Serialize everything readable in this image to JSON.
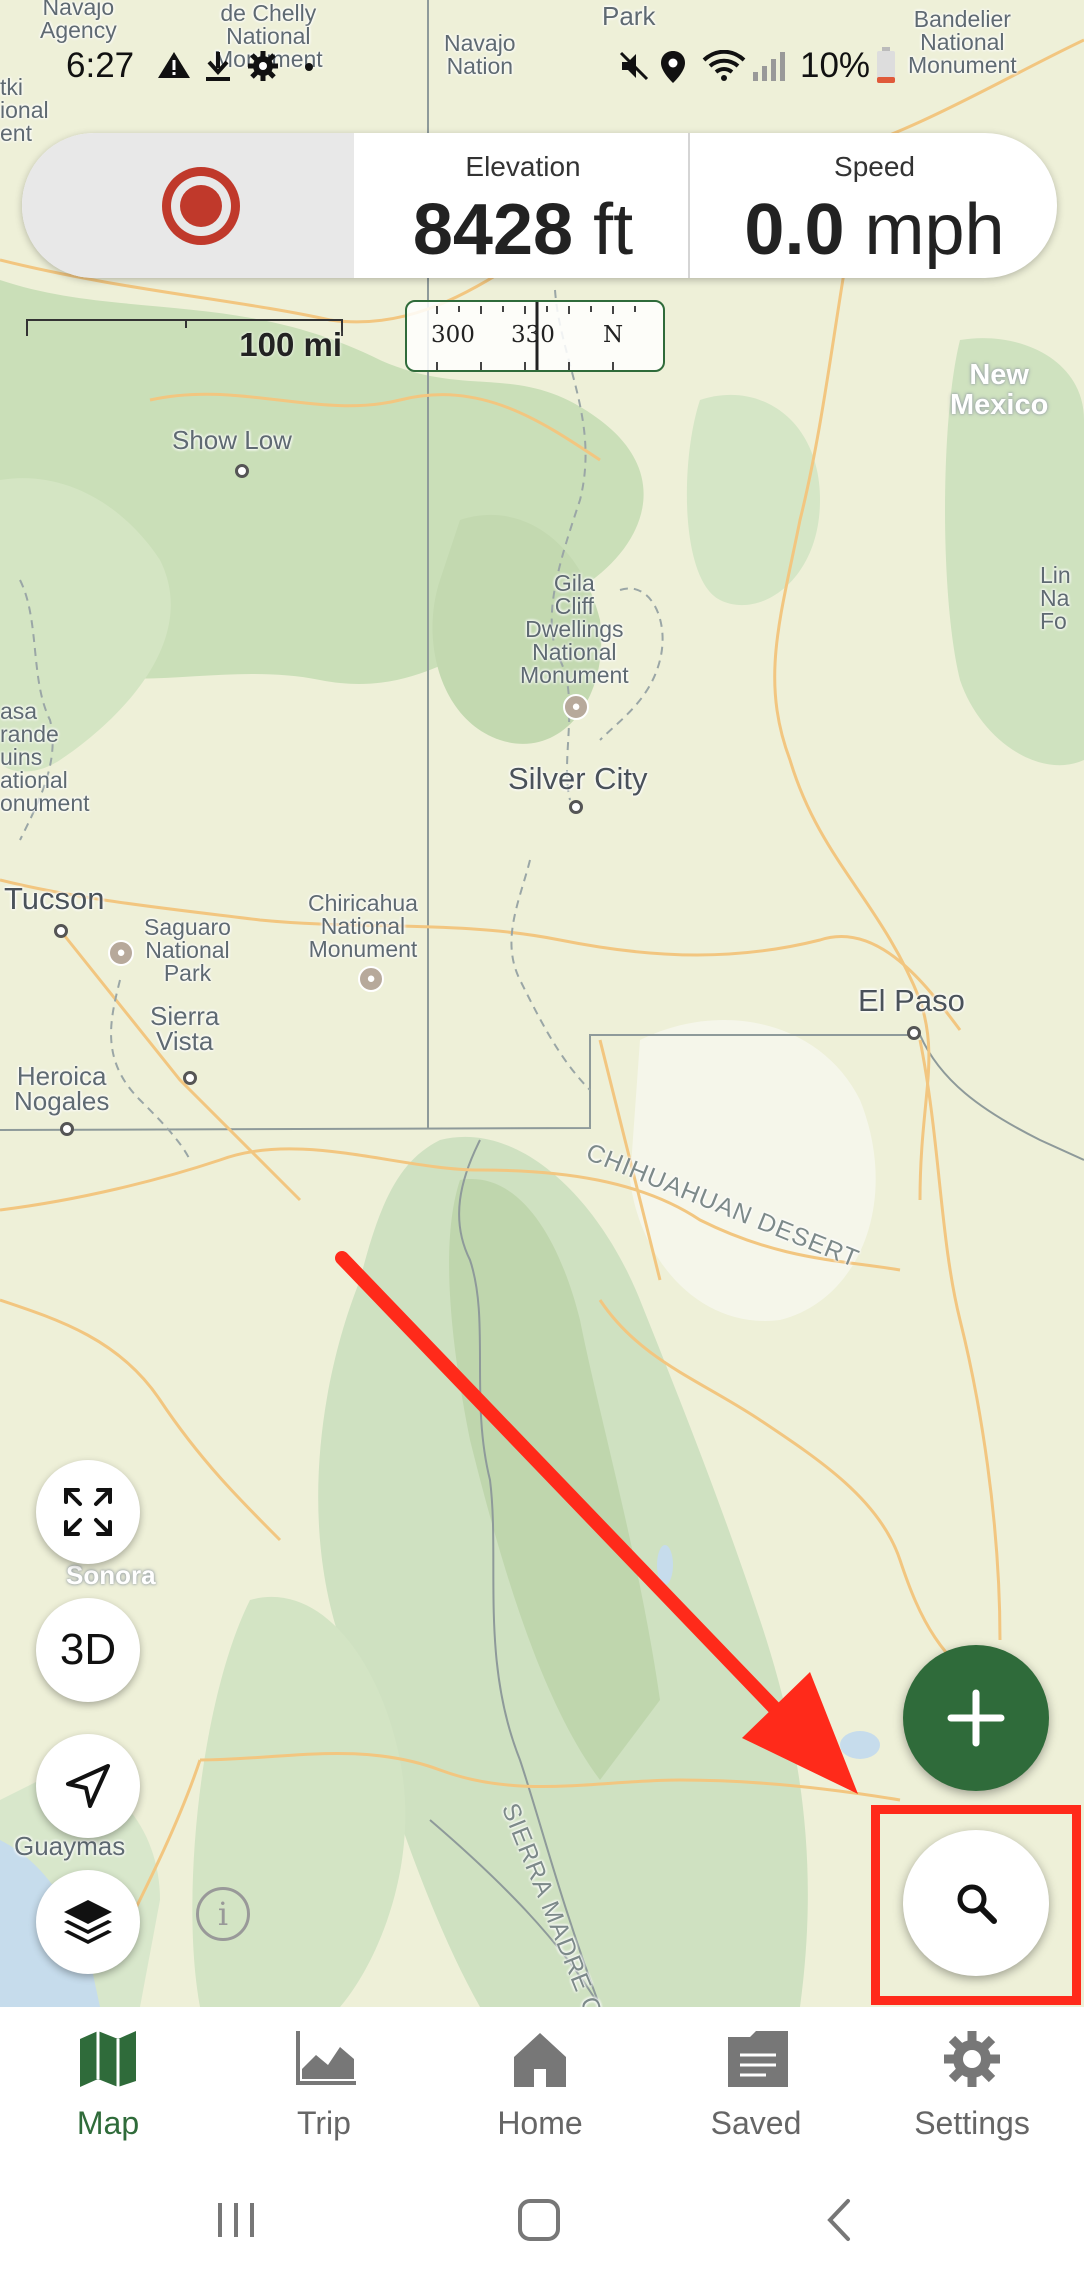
{
  "status_bar": {
    "time": "6:27",
    "battery": "10%",
    "icons": [
      "alert-icon",
      "download-icon",
      "settings-icon",
      "mute-icon",
      "location-icon",
      "wifi-icon",
      "signal-icon",
      "battery-icon"
    ]
  },
  "top_card": {
    "record_icon": "record-icon",
    "elevation": {
      "label": "Elevation",
      "value": "8428",
      "unit": "ft"
    },
    "speed": {
      "label": "Speed",
      "value": "0.0",
      "unit": "mph"
    }
  },
  "scale": {
    "label": "100 mi"
  },
  "compass": {
    "ticks": [
      "300",
      "330",
      "N"
    ]
  },
  "map_labels": {
    "navajo_agency": "Navajo\nAgency",
    "canyon_de_chelly": "de Chelly\nNational\nMonument",
    "navajo_nation": "Navajo\nNation",
    "park": "Park",
    "bandelier": "Bandelier\nNational\nMonument",
    "ketki": "tki\nional\nent",
    "new_mexico": "New\nMexico",
    "show_low": "Show Low",
    "gila_cliff": "Gila\nCliff\nDwellings\nNational\nMonument",
    "lincoln": "Lin\nNa\nFo",
    "casa_grande": "asa\nrande\nuins\national\nonument",
    "silver_city": "Silver City",
    "tucson": "Tucson",
    "saguaro": "Saguaro\nNational\nPark",
    "chiricahua": "Chiricahua\nNational\nMonument",
    "el_paso": "El Paso",
    "sierra_vista": "Sierra\nVista",
    "heroica_nogales": "Heroica\nNogales",
    "chihuahuan_desert": "CHIHUAHUAN DESERT",
    "sonora": "Sonora",
    "guaymas": "Guaymas",
    "sierra_madre": "SIERRA MADRE OC"
  },
  "map_controls": {
    "fullscreen": "fullscreen-icon",
    "three_d": "3D",
    "locate": "navigation-arrow-icon",
    "layers": "layers-icon",
    "info": "i"
  },
  "fab": {
    "add": "plus-icon",
    "search": "search-icon"
  },
  "bottom_nav": {
    "items": [
      {
        "label": "Map",
        "icon": "map-icon",
        "active": true
      },
      {
        "label": "Trip",
        "icon": "chart-icon",
        "active": false
      },
      {
        "label": "Home",
        "icon": "home-icon",
        "active": false
      },
      {
        "label": "Saved",
        "icon": "folder-icon",
        "active": false
      },
      {
        "label": "Settings",
        "icon": "gear-icon",
        "active": false
      }
    ]
  },
  "colors": {
    "accent_green": "#2f6b3a",
    "record_red": "#c0392b",
    "annotation_red": "#ff2a1a",
    "map_background": "#eef0d8",
    "forest_green": "#cfe0bf"
  }
}
